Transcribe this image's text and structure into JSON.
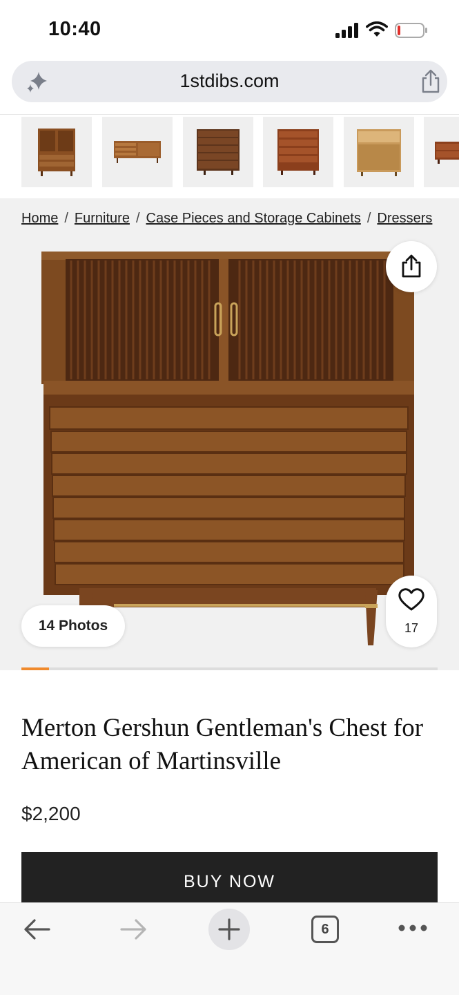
{
  "status": {
    "time": "10:40",
    "icons": [
      "cellular-signal-icon",
      "wifi-icon",
      "battery-low-icon"
    ]
  },
  "browser": {
    "url": "1stdibs.com",
    "left_icon": "sparkle-icon",
    "right_icon": "share-icon"
  },
  "thumbnails": [
    {
      "name": "thumb-1",
      "icon": "highboy-chest-icon"
    },
    {
      "name": "thumb-2",
      "icon": "credenza-icon"
    },
    {
      "name": "thumb-3",
      "icon": "tall-dresser-icon"
    },
    {
      "name": "thumb-4",
      "icon": "dresser-icon"
    },
    {
      "name": "thumb-5",
      "icon": "light-dresser-icon"
    },
    {
      "name": "thumb-6",
      "icon": "dresser-partial-icon"
    }
  ],
  "breadcrumb": {
    "items": [
      "Home",
      "Furniture",
      "Case Pieces and Storage Cabinets",
      "Dressers"
    ],
    "separator": "/"
  },
  "gallery": {
    "photos_label": "14 Photos",
    "favorites_count": "17",
    "progress": 0.066,
    "accent_color": "#f08a2c"
  },
  "product": {
    "title": "Merton Gershun Gentleman's Chest for American of Martinsville",
    "price": "$2,200",
    "buy_label": "BUY NOW"
  },
  "toolbar": {
    "tabs_count": "6",
    "icons": [
      "back-arrow-icon",
      "forward-arrow-icon",
      "plus-icon",
      "tabs-icon",
      "more-icon"
    ]
  }
}
